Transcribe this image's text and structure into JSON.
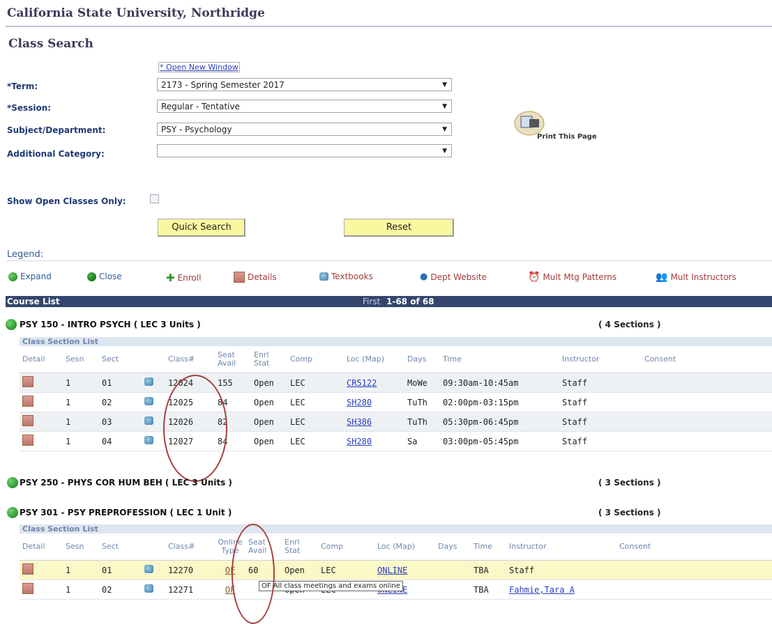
{
  "header": {
    "university": "California State University, Northridge",
    "page_title": "Class Search"
  },
  "form": {
    "open_new_window": "* Open New Window",
    "term_label": "*Term:",
    "term_value": "2173 - Spring Semester 2017",
    "session_label": "*Session:",
    "session_value": "Regular - Tentative",
    "subject_label": "Subject/Department:",
    "subject_value": "PSY - Psychology",
    "category_label": "Additional Category:",
    "category_value": "",
    "open_only_label": "Show Open Classes Only:",
    "quick_search": "Quick Search",
    "reset": "Reset",
    "print": "Print This Page"
  },
  "legend": {
    "title": "Legend:",
    "items": [
      "Expand",
      "Close",
      "Enroll",
      "Details",
      "Textbooks",
      "Dept Website",
      "Mult Mtg Patterns",
      "Mult Instructors"
    ]
  },
  "course_list": {
    "title": "Course List",
    "pager": "First",
    "range": "1-68 of 68"
  },
  "courses": [
    {
      "title": "PSY 150 - INTRO PSYCH ( LEC  3 Units )",
      "sections": "( 4 Sections )",
      "list_label": "Class Section List",
      "headers": [
        "Detail",
        "Sesn",
        "Sect",
        "",
        "Class#",
        "Seat Avail",
        "Enrl Stat",
        "Comp",
        "Loc (Map)",
        "Days",
        "Time",
        "Instructor",
        "Consent"
      ],
      "rows": [
        [
          "1",
          "01",
          "12024",
          "155",
          "Open",
          "LEC",
          "CR5122",
          "MoWe",
          "09:30am-10:45am",
          "Staff"
        ],
        [
          "1",
          "02",
          "12025",
          "84",
          "Open",
          "LEC",
          "SH280",
          "TuTh",
          "02:00pm-03:15pm",
          "Staff"
        ],
        [
          "1",
          "03",
          "12026",
          "82",
          "Open",
          "LEC",
          "SH386",
          "TuTh",
          "05:30pm-06:45pm",
          "Staff"
        ],
        [
          "1",
          "04",
          "12027",
          "84",
          "Open",
          "LEC",
          "SH280",
          "Sa",
          "03:00pm-05:45pm",
          "Staff"
        ]
      ]
    },
    {
      "title": "PSY 250 - PHYS COR HUM BEH ( LEC  3 Units )",
      "sections": "( 3 Sections )"
    },
    {
      "title": "PSY 301 - PSY PREPROFESSION ( LEC  1 Unit )",
      "sections": "( 3 Sections )",
      "list_label": "Class Section List",
      "headers": [
        "Detail",
        "Sesn",
        "Sect",
        "",
        "Class#",
        "Online Type",
        "Seat Avail",
        "Enrl Stat",
        "Comp",
        "Loc (Map)",
        "Days",
        "Time",
        "Instructor",
        "Consent"
      ],
      "rows": [
        [
          "1",
          "01",
          "12270",
          "OF",
          "60",
          "Open",
          "LEC",
          "ONLINE",
          "",
          "TBA",
          "Staff"
        ],
        [
          "1",
          "02",
          "12271",
          "OF",
          "",
          "Open",
          "LEC",
          "ONLINE",
          "",
          "TBA",
          "Fahmie,Tara A"
        ]
      ]
    }
  ],
  "tooltip": "OF  All class meetings and exams online"
}
